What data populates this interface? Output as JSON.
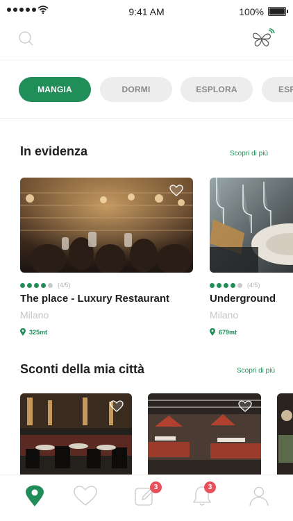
{
  "status_bar": {
    "time": "9:41 AM",
    "battery": "100%"
  },
  "header": {
    "search_icon": "search-icon",
    "logo_icon": "butterfly-logo-icon"
  },
  "tabs": [
    {
      "label": "MANGIA",
      "active": true
    },
    {
      "label": "DORMI",
      "active": false
    },
    {
      "label": "ESPLORA",
      "active": false
    },
    {
      "label": "ESP",
      "active": false
    }
  ],
  "featured": {
    "title": "In evidenza",
    "link": "Scopri di più",
    "cards": [
      {
        "name": "The place - Luxury Restaurant",
        "city": "Milano",
        "distance": "325mt",
        "rating": 4,
        "rating_text": "(4/5)"
      },
      {
        "name": "Underground",
        "city": "Milano",
        "distance": "679mt",
        "rating": 4,
        "rating_text": "(4/5)"
      }
    ]
  },
  "discounts": {
    "title": "Sconti della mia città",
    "link": "Scopri di più"
  },
  "bottom_nav": {
    "items": [
      "location-pin-icon",
      "heart-icon",
      "edit-icon",
      "bell-icon",
      "user-icon"
    ],
    "badges": {
      "edit": "3",
      "bell": "3"
    }
  },
  "colors": {
    "accent": "#218e5a",
    "badge": "#e8505b"
  }
}
